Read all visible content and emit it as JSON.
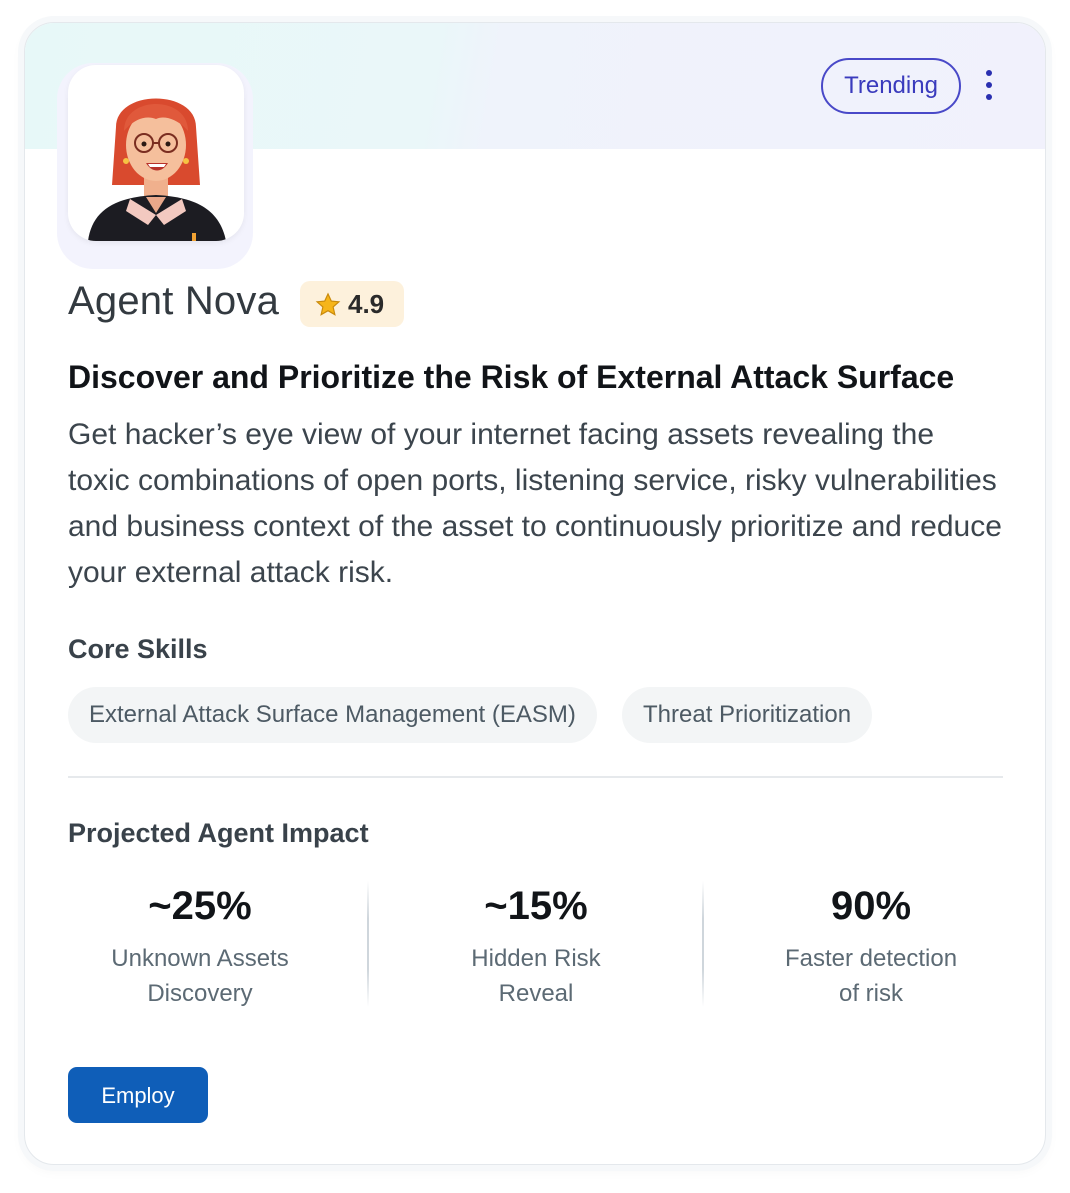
{
  "badge": {
    "label": "Trending"
  },
  "menu": {
    "icon": "more-vertical-icon"
  },
  "agent": {
    "avatar_icon": "agent-avatar-illustration",
    "name": "Agent Nova",
    "rating": "4.9",
    "rating_icon": "star-icon"
  },
  "headline": "Discover and Prioritize the Risk of External Attack Surface",
  "description": "Get hacker’s eye view of your internet facing assets revealing the toxic combinations of open ports, listening service, risky vulnerabilities and business context of the asset to continuously prioritize and reduce your external attack risk.",
  "skills": {
    "title": "Core Skills",
    "items": [
      "External Attack Surface Management (EASM)",
      "Threat Prioritization"
    ]
  },
  "impact": {
    "title": "Projected Agent Impact",
    "metrics": [
      {
        "value": "~25%",
        "label_line1": "Unknown Assets",
        "label_line2": "Discovery"
      },
      {
        "value": "~15%",
        "label_line1": "Hidden Risk",
        "label_line2": "Reveal"
      },
      {
        "value": "90%",
        "label_line1": "Faster detection",
        "label_line2": "of risk"
      }
    ]
  },
  "actions": {
    "employ_label": "Employ"
  },
  "colors": {
    "accent": "#0f5eb8",
    "badge_border": "#4949c8",
    "rating_bg": "#fdf1dc",
    "star": "#f6b51a"
  }
}
